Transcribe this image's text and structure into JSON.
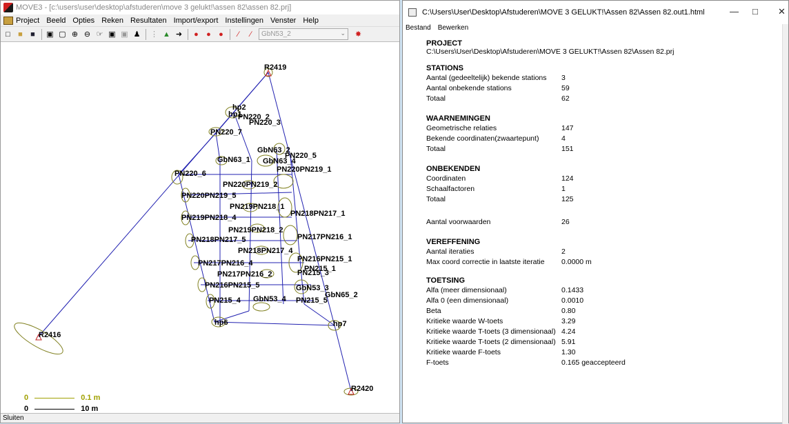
{
  "left_window": {
    "title": "MOVE3 - [c:\\users\\user\\desktop\\afstuderen\\move 3 gelukt!\\assen 82\\assen 82.prj]",
    "menu": [
      "Project",
      "Beeld",
      "Opties",
      "Reken",
      "Resultaten",
      "Import/export",
      "Instellingen",
      "Venster",
      "Help"
    ],
    "combo_value": "GbN53_2",
    "status": "Sluiten",
    "scale_bar": [
      {
        "left": "0",
        "right": "0.1 m"
      },
      {
        "left": "0",
        "right": "10 m"
      }
    ],
    "colors": {
      "scale_text": "#a0a000",
      "network_line": "#2020b0",
      "ellipse": "#808020",
      "known_station": "#c02020"
    },
    "stations": [
      {
        "name": "R2419"
      },
      {
        "name": "R2416"
      },
      {
        "name": "R2420"
      },
      {
        "name": "hp2"
      },
      {
        "name": "hp1"
      },
      {
        "name": "hp6"
      },
      {
        "name": "hp7"
      },
      {
        "name": "PN220_2"
      },
      {
        "name": "PN220_3"
      },
      {
        "name": "PN220_7"
      },
      {
        "name": "PN220_6"
      },
      {
        "name": "GbN63_1"
      },
      {
        "name": "GbN63_2"
      },
      {
        "name": "PN220_5"
      },
      {
        "name": "GbN63_4"
      },
      {
        "name": "PN220PN219_1"
      },
      {
        "name": "PN220PN219_2"
      },
      {
        "name": "PN220PN219_5"
      },
      {
        "name": "PN219PN218_4"
      },
      {
        "name": "PN219PN218_1"
      },
      {
        "name": "PN218PN217_5"
      },
      {
        "name": "PN218PN217_1"
      },
      {
        "name": "PN217PN216_4"
      },
      {
        "name": "PN217PN216_1"
      },
      {
        "name": "PN216PN215_5"
      },
      {
        "name": "PN216PN215_1"
      },
      {
        "name": "PN215_4"
      },
      {
        "name": "GbN53_4"
      },
      {
        "name": "GbN53_3"
      },
      {
        "name": "PN215_5"
      },
      {
        "name": "GbN65_2"
      },
      {
        "name": "PN215_3"
      },
      {
        "name": "PN215_1"
      },
      {
        "name": "PN219PN218_2"
      },
      {
        "name": "PN218PN217_4"
      },
      {
        "name": "PN217PN216_2"
      }
    ]
  },
  "right_window": {
    "title": "C:\\Users\\User\\Desktop\\Afstuderen\\MOVE 3 GELUKT!\\Assen 82\\Assen 82.out1.html",
    "menu": [
      "Bestand",
      "Bewerken"
    ],
    "project": {
      "heading": "PROJECT",
      "path": "C:\\Users\\User\\Desktop\\Afstuderen\\MOVE 3 GELUKT!\\Assen 82\\Assen 82.prj"
    },
    "sections": [
      {
        "heading": "STATIONS",
        "rows": [
          {
            "k": "Aantal (gedeeltelijk) bekende stations",
            "v": "3"
          },
          {
            "k": "Aantal onbekende stations",
            "v": "59"
          },
          {
            "k": "Totaal",
            "v": "62"
          }
        ]
      },
      {
        "heading": "WAARNEMINGEN",
        "rows": [
          {
            "k": "Geometrische relaties",
            "v": "147"
          },
          {
            "k": "Bekende coordinaten(zwaartepunt)",
            "v": "4"
          },
          {
            "k": "Totaal",
            "v": "151"
          }
        ]
      },
      {
        "heading": "ONBEKENDEN",
        "rows": [
          {
            "k": "Coordinaten",
            "v": "124"
          },
          {
            "k": "Schaalfactoren",
            "v": "1"
          },
          {
            "k": "Totaal",
            "v": "125"
          }
        ]
      },
      {
        "heading": "",
        "rows": [
          {
            "k": "Aantal voorwaarden",
            "v": "26"
          }
        ]
      },
      {
        "heading": "VEREFFENING",
        "rows": [
          {
            "k": "Aantal iteraties",
            "v": "2"
          },
          {
            "k": "Max coord correctie in laatste iteratie",
            "v": "0.0000 m"
          }
        ]
      },
      {
        "heading": "TOETSING",
        "rows": [
          {
            "k": "Alfa (meer dimensionaal)",
            "v": "0.1433"
          },
          {
            "k": "Alfa 0 (een dimensionaal)",
            "v": "0.0010"
          },
          {
            "k": "Beta",
            "v": "0.80"
          },
          {
            "k": "Kritieke waarde W-toets",
            "v": "3.29"
          },
          {
            "k": "Kritieke waarde T-toets (3 dimensionaal)",
            "v": "4.24"
          },
          {
            "k": "Kritieke waarde T-toets (2 dimensionaal)",
            "v": "5.91"
          },
          {
            "k": "Kritieke waarde F-toets",
            "v": "1.30"
          },
          {
            "k": "F-toets",
            "v": "0.165 geaccepteerd"
          }
        ]
      }
    ]
  }
}
